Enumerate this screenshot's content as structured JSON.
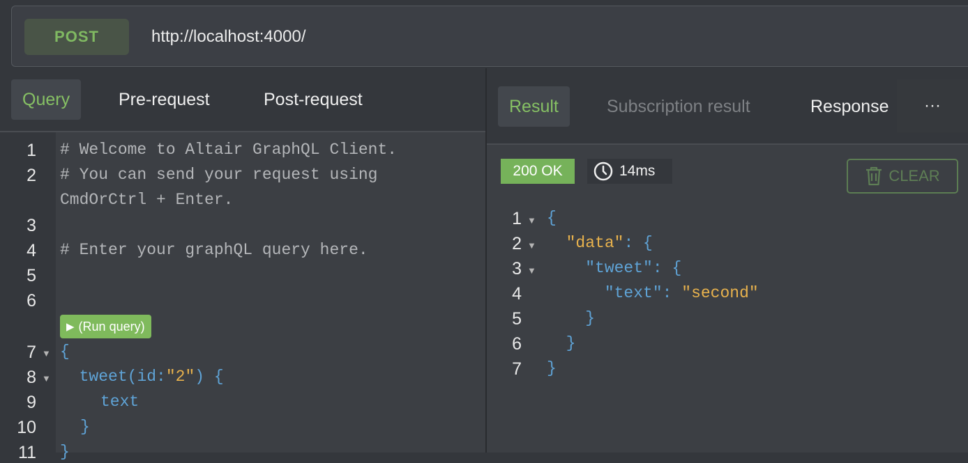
{
  "request": {
    "method": "POST",
    "url": "http://localhost:4000/"
  },
  "left_tabs": [
    {
      "label": "Query",
      "active": true
    },
    {
      "label": "Pre-request",
      "active": false
    },
    {
      "label": "Post-request",
      "active": false
    }
  ],
  "right_tabs": [
    {
      "label": "Result",
      "active": true
    },
    {
      "label": "Subscription result",
      "active": false
    },
    {
      "label": "Response",
      "active": false
    }
  ],
  "more_label": "···",
  "editor": {
    "line_numbers": [
      "1",
      "2",
      "3",
      "4",
      "5",
      "6",
      "7",
      "8",
      "9",
      "10",
      "11"
    ],
    "comment_1": "# Welcome to Altair GraphQL Client.",
    "comment_2a": "# You can send your request using",
    "comment_2b": "CmdOrCtrl + Enter.",
    "comment_4": "# Enter your graphQL query here.",
    "run_query_label": "(Run query)",
    "code_7": "{",
    "code_8_field": "tweet",
    "code_8_arg": "id",
    "code_8_value": "\"2\"",
    "code_9": "text",
    "code_10": "}",
    "code_11": "}"
  },
  "result": {
    "status": "200 OK",
    "time": "14ms",
    "clear_label": "CLEAR",
    "line_numbers": [
      "1",
      "2",
      "3",
      "4",
      "5",
      "6",
      "7"
    ],
    "key_data": "\"data\"",
    "key_tweet": "\"tweet\"",
    "key_text": "\"text\"",
    "value_text": "\"second\""
  },
  "colors": {
    "accent_green": "#86c064",
    "status_green": "#76b25a",
    "keyword_blue": "#5fa3d6",
    "string_orange": "#e8b24d",
    "background": "#34373c"
  },
  "icons": [
    "play-icon",
    "clock-icon",
    "trash-icon",
    "fold-arrow-icon"
  ]
}
